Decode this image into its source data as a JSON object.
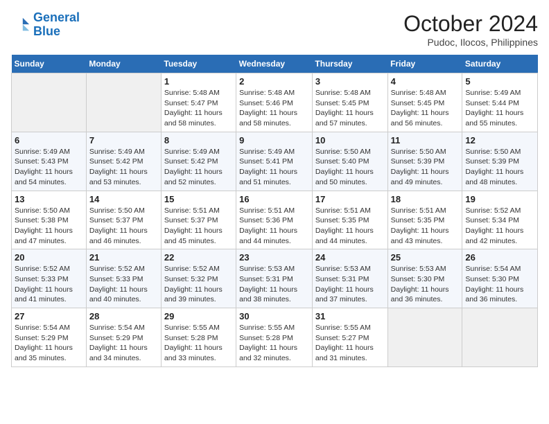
{
  "header": {
    "logo_line1": "General",
    "logo_line2": "Blue",
    "month": "October 2024",
    "location": "Pudoc, Ilocos, Philippines"
  },
  "days_of_week": [
    "Sunday",
    "Monday",
    "Tuesday",
    "Wednesday",
    "Thursday",
    "Friday",
    "Saturday"
  ],
  "weeks": [
    [
      {
        "day": "",
        "empty": true
      },
      {
        "day": "",
        "empty": true
      },
      {
        "day": "1",
        "sunrise": "Sunrise: 5:48 AM",
        "sunset": "Sunset: 5:47 PM",
        "daylight": "Daylight: 11 hours and 58 minutes."
      },
      {
        "day": "2",
        "sunrise": "Sunrise: 5:48 AM",
        "sunset": "Sunset: 5:46 PM",
        "daylight": "Daylight: 11 hours and 58 minutes."
      },
      {
        "day": "3",
        "sunrise": "Sunrise: 5:48 AM",
        "sunset": "Sunset: 5:45 PM",
        "daylight": "Daylight: 11 hours and 57 minutes."
      },
      {
        "day": "4",
        "sunrise": "Sunrise: 5:48 AM",
        "sunset": "Sunset: 5:45 PM",
        "daylight": "Daylight: 11 hours and 56 minutes."
      },
      {
        "day": "5",
        "sunrise": "Sunrise: 5:49 AM",
        "sunset": "Sunset: 5:44 PM",
        "daylight": "Daylight: 11 hours and 55 minutes."
      }
    ],
    [
      {
        "day": "6",
        "sunrise": "Sunrise: 5:49 AM",
        "sunset": "Sunset: 5:43 PM",
        "daylight": "Daylight: 11 hours and 54 minutes."
      },
      {
        "day": "7",
        "sunrise": "Sunrise: 5:49 AM",
        "sunset": "Sunset: 5:42 PM",
        "daylight": "Daylight: 11 hours and 53 minutes."
      },
      {
        "day": "8",
        "sunrise": "Sunrise: 5:49 AM",
        "sunset": "Sunset: 5:42 PM",
        "daylight": "Daylight: 11 hours and 52 minutes."
      },
      {
        "day": "9",
        "sunrise": "Sunrise: 5:49 AM",
        "sunset": "Sunset: 5:41 PM",
        "daylight": "Daylight: 11 hours and 51 minutes."
      },
      {
        "day": "10",
        "sunrise": "Sunrise: 5:50 AM",
        "sunset": "Sunset: 5:40 PM",
        "daylight": "Daylight: 11 hours and 50 minutes."
      },
      {
        "day": "11",
        "sunrise": "Sunrise: 5:50 AM",
        "sunset": "Sunset: 5:39 PM",
        "daylight": "Daylight: 11 hours and 49 minutes."
      },
      {
        "day": "12",
        "sunrise": "Sunrise: 5:50 AM",
        "sunset": "Sunset: 5:39 PM",
        "daylight": "Daylight: 11 hours and 48 minutes."
      }
    ],
    [
      {
        "day": "13",
        "sunrise": "Sunrise: 5:50 AM",
        "sunset": "Sunset: 5:38 PM",
        "daylight": "Daylight: 11 hours and 47 minutes."
      },
      {
        "day": "14",
        "sunrise": "Sunrise: 5:50 AM",
        "sunset": "Sunset: 5:37 PM",
        "daylight": "Daylight: 11 hours and 46 minutes."
      },
      {
        "day": "15",
        "sunrise": "Sunrise: 5:51 AM",
        "sunset": "Sunset: 5:37 PM",
        "daylight": "Daylight: 11 hours and 45 minutes."
      },
      {
        "day": "16",
        "sunrise": "Sunrise: 5:51 AM",
        "sunset": "Sunset: 5:36 PM",
        "daylight": "Daylight: 11 hours and 44 minutes."
      },
      {
        "day": "17",
        "sunrise": "Sunrise: 5:51 AM",
        "sunset": "Sunset: 5:35 PM",
        "daylight": "Daylight: 11 hours and 44 minutes."
      },
      {
        "day": "18",
        "sunrise": "Sunrise: 5:51 AM",
        "sunset": "Sunset: 5:35 PM",
        "daylight": "Daylight: 11 hours and 43 minutes."
      },
      {
        "day": "19",
        "sunrise": "Sunrise: 5:52 AM",
        "sunset": "Sunset: 5:34 PM",
        "daylight": "Daylight: 11 hours and 42 minutes."
      }
    ],
    [
      {
        "day": "20",
        "sunrise": "Sunrise: 5:52 AM",
        "sunset": "Sunset: 5:33 PM",
        "daylight": "Daylight: 11 hours and 41 minutes."
      },
      {
        "day": "21",
        "sunrise": "Sunrise: 5:52 AM",
        "sunset": "Sunset: 5:33 PM",
        "daylight": "Daylight: 11 hours and 40 minutes."
      },
      {
        "day": "22",
        "sunrise": "Sunrise: 5:52 AM",
        "sunset": "Sunset: 5:32 PM",
        "daylight": "Daylight: 11 hours and 39 minutes."
      },
      {
        "day": "23",
        "sunrise": "Sunrise: 5:53 AM",
        "sunset": "Sunset: 5:31 PM",
        "daylight": "Daylight: 11 hours and 38 minutes."
      },
      {
        "day": "24",
        "sunrise": "Sunrise: 5:53 AM",
        "sunset": "Sunset: 5:31 PM",
        "daylight": "Daylight: 11 hours and 37 minutes."
      },
      {
        "day": "25",
        "sunrise": "Sunrise: 5:53 AM",
        "sunset": "Sunset: 5:30 PM",
        "daylight": "Daylight: 11 hours and 36 minutes."
      },
      {
        "day": "26",
        "sunrise": "Sunrise: 5:54 AM",
        "sunset": "Sunset: 5:30 PM",
        "daylight": "Daylight: 11 hours and 36 minutes."
      }
    ],
    [
      {
        "day": "27",
        "sunrise": "Sunrise: 5:54 AM",
        "sunset": "Sunset: 5:29 PM",
        "daylight": "Daylight: 11 hours and 35 minutes."
      },
      {
        "day": "28",
        "sunrise": "Sunrise: 5:54 AM",
        "sunset": "Sunset: 5:29 PM",
        "daylight": "Daylight: 11 hours and 34 minutes."
      },
      {
        "day": "29",
        "sunrise": "Sunrise: 5:55 AM",
        "sunset": "Sunset: 5:28 PM",
        "daylight": "Daylight: 11 hours and 33 minutes."
      },
      {
        "day": "30",
        "sunrise": "Sunrise: 5:55 AM",
        "sunset": "Sunset: 5:28 PM",
        "daylight": "Daylight: 11 hours and 32 minutes."
      },
      {
        "day": "31",
        "sunrise": "Sunrise: 5:55 AM",
        "sunset": "Sunset: 5:27 PM",
        "daylight": "Daylight: 11 hours and 31 minutes."
      },
      {
        "day": "",
        "empty": true
      },
      {
        "day": "",
        "empty": true
      }
    ]
  ]
}
